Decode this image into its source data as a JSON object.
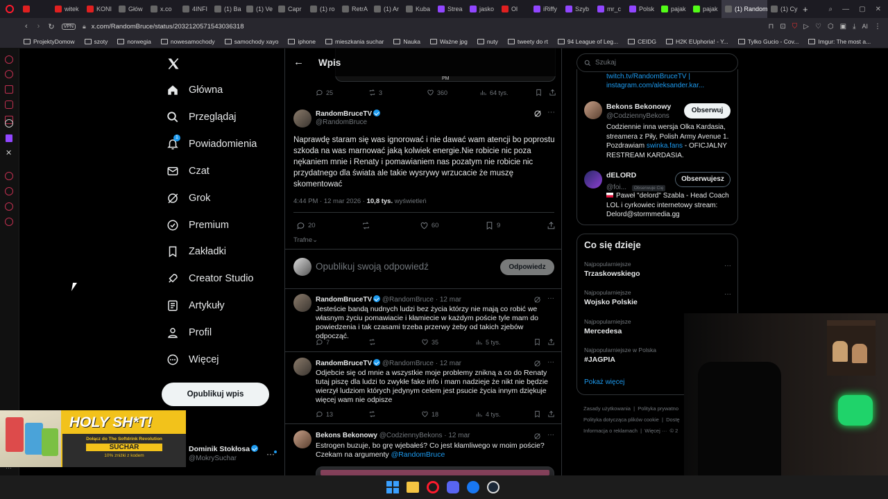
{
  "browser": {
    "tabs": [
      {
        "label": "",
        "color": "#e02020"
      },
      {
        "label": "witek",
        "color": "#e02020"
      },
      {
        "label": "KONI",
        "color": "#e02020"
      },
      {
        "label": "Głów",
        "color": "#666"
      },
      {
        "label": "x.co",
        "color": "#666"
      },
      {
        "label": "4INFI",
        "color": "#666"
      },
      {
        "label": "(1) Ba",
        "color": "#666"
      },
      {
        "label": "(1) Ve",
        "color": "#666"
      },
      {
        "label": "Capr",
        "color": "#666"
      },
      {
        "label": "(1) ro",
        "color": "#666"
      },
      {
        "label": "RetrA",
        "color": "#666"
      },
      {
        "label": "(1) Ar",
        "color": "#666"
      },
      {
        "label": "Kuba",
        "color": "#666"
      },
      {
        "label": "Strea",
        "color": "#9146ff"
      },
      {
        "label": "jasko",
        "color": "#9146ff"
      },
      {
        "label": "Ol",
        "color": "#e02020"
      },
      {
        "label": "iRiffy",
        "color": "#9146ff"
      },
      {
        "label": "Szyb",
        "color": "#9146ff"
      },
      {
        "label": "mr_c",
        "color": "#9146ff"
      },
      {
        "label": "Polsk",
        "color": "#9146ff"
      },
      {
        "label": "pajak",
        "color": "#53fc18"
      },
      {
        "label": "pajak",
        "color": "#53fc18"
      },
      {
        "label": "(1) Random",
        "color": "#666",
        "active": true
      },
      {
        "label": "(1) Cy",
        "color": "#666"
      }
    ],
    "vpn_label": "VPN",
    "url": "x.com/RandomBruce/status/2032120571543036318",
    "ai_label": "AI",
    "bookmarks": [
      "ProjektyDomow",
      "szoty",
      "norwegia",
      "nowesamochody",
      "samochody xayo",
      "iphone",
      "mieszkania suchar",
      "Nauka",
      "Ważne jpg",
      "nuty",
      "tweety do rt",
      "94 League of Leg...",
      "CEIDG",
      "H2K EUphoria! - Y...",
      "Tylko Gucio - Cov...",
      "Imgur: The most a..."
    ]
  },
  "nav": {
    "items": [
      {
        "label": "Główna",
        "icon": "home-icon"
      },
      {
        "label": "Przeglądaj",
        "icon": "search-icon"
      },
      {
        "label": "Powiadomienia",
        "icon": "bell-icon",
        "badge": "1"
      },
      {
        "label": "Czat",
        "icon": "mail-icon"
      },
      {
        "label": "Grok",
        "icon": "grok-icon"
      },
      {
        "label": "Premium",
        "icon": "premium-icon"
      },
      {
        "label": "Zakładki",
        "icon": "bookmark-icon"
      },
      {
        "label": "Creator Studio",
        "icon": "rocket-icon"
      },
      {
        "label": "Artykuły",
        "icon": "article-icon"
      },
      {
        "label": "Profil",
        "icon": "profile-icon"
      },
      {
        "label": "Więcej",
        "icon": "more-icon"
      }
    ],
    "post_button": "Opublikuj wpis",
    "account": {
      "name": "Dominik Stokłosa",
      "handle": "@MokrySuchar"
    }
  },
  "ad": {
    "headline": "HOLY SH*T!",
    "line1": "Dołącz do The Softdrink Revolution",
    "brand": "SUCHAR",
    "promo": "10% zniżki z kodem"
  },
  "header": {
    "title": "Wpis"
  },
  "prev_post": {
    "time_fragment": "PM",
    "replies": "25",
    "reposts": "3",
    "likes": "360",
    "views": "64 tys."
  },
  "main_post": {
    "name": "RandomBruceTV",
    "handle": "@RandomBruce",
    "text": "Naprawdę staram się was ignorować i nie dawać wam atencji bo poprostu szkoda na was marnować jaką kolwiek energie.Nie robicie nic poza nękaniem mnie i Renaty i pomawianiem nas pozatym nie robicie nic przydatnego dla świata ale takie wysrywy wrzucacie że muszę skomentować",
    "time": "4:44 PM · 12 mar 2026 · ",
    "views": "10,8 tys.",
    "views_label": " wyświetleń",
    "replies": "20",
    "reposts": "",
    "likes": "60",
    "bookmarks": "9",
    "sort_label": "Trafne"
  },
  "composer": {
    "placeholder": "Opublikuj swoją odpowiedź",
    "button": "Odpowiedz"
  },
  "replies": [
    {
      "name": "RandomBruceTV",
      "handle": "@RandomBruce · 12 mar",
      "verified": true,
      "text": "Jesteście bandą nudnych ludzi bez życia którzy nie mają co robić we własnym życiu pomawiacie i kłamiecie w każdym poście tyle mam do powiedzenia i tak czasami trzeba przerwy żeby od takich zjebów odpocząć.",
      "replies": "7",
      "reposts": "",
      "likes": "35",
      "views": "5 tys."
    },
    {
      "name": "RandomBruceTV",
      "handle": "@RandomBruce · 12 mar",
      "verified": true,
      "text": "Odjebcie się od mnie a wszystkie moje problemy znikną a co do Renaty tutaj piszę dla ludzi to zwykłe fake info i mam nadzieje że nikt nie będzie wierzył ludziom których jedynym celem jest psucie życia innym dziękuje więcej wam nie odpisze",
      "replies": "13",
      "reposts": "",
      "likes": "18",
      "views": "4 tys."
    },
    {
      "name": "Bekons Bekonowy",
      "handle": "@CodziennyBekons · 12 mar",
      "verified": false,
      "text": "Estrogen buzuje, bo grę wjebałeś? Co jest kłamliwego w moim poście? Czekam na argumenty ",
      "mention": "@RandomBruce"
    }
  ],
  "right": {
    "search_placeholder": "Szukaj",
    "bio_links": [
      "twitch.tv/RandomBruceTV |",
      "instagram.com/aleksander.kar..."
    ],
    "who_to_follow": [
      {
        "name": "Bekons Bekonowy",
        "handle": "@CodziennyBekons",
        "button": "Obserwuj",
        "bio_pre": "Codziennie inna wersja Olka Kardasia, streamera z Piły, Polish Army Avenue 1. Pozdrawiam ",
        "bio_link": "swinka.fans",
        "bio_post": " - OFICJALNY RESTREAM KARDASIA."
      },
      {
        "name": "dELORD",
        "handle": "@foi...",
        "follows_you": "Obserwuje Cię",
        "button": "Obserwujesz",
        "bio": "Paweł \"delord\" Szabla - Head Coach LOL i cyrkowiec internetowy stream: Delord@stormmedia.gg"
      }
    ],
    "trends_title": "Co się dzieje",
    "trends": [
      {
        "category": "Najpopularniejsze",
        "name": "Trzaskowskiego"
      },
      {
        "category": "Najpopularniejsze",
        "name": "Wojsko Polskie"
      },
      {
        "category": "Najpopularniejsze",
        "name": "Mercedesa"
      },
      {
        "category": "Najpopularniejsze w Polska",
        "name": "#JAGPIA"
      }
    ],
    "show_more": "Pokaż więcej",
    "footer": [
      "Zasady użytkowania",
      "|",
      "Polityka prywatno",
      "Polityka dotycząca plików cookie",
      "|",
      "Dostę",
      "Informacja o reklamach",
      "|",
      "Więcej ···",
      "© 2"
    ]
  }
}
